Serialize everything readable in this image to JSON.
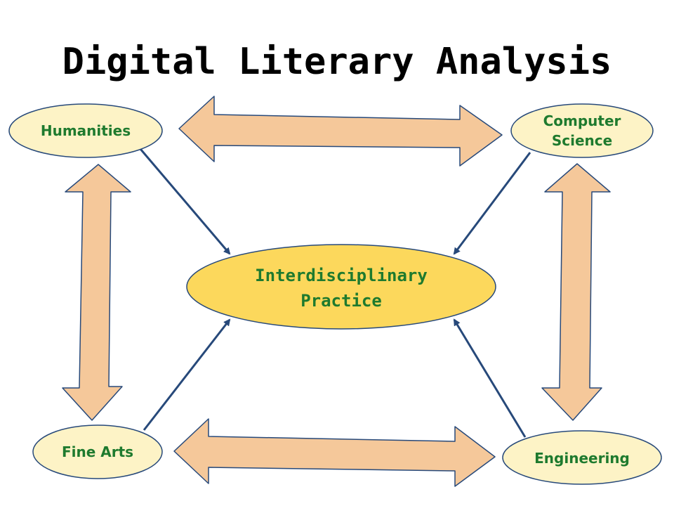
{
  "title": "Digital Literary Analysis",
  "center": {
    "lines": [
      "Interdisciplinary",
      "Practice"
    ]
  },
  "nodes": {
    "humanities": {
      "lines": [
        "Humanities"
      ]
    },
    "computer_science": {
      "lines": [
        "Computer",
        "Science"
      ]
    },
    "fine_arts": {
      "lines": [
        "Fine Arts"
      ]
    },
    "engineering": {
      "lines": [
        "Engineering"
      ]
    }
  },
  "colors": {
    "node_fill": "#fdf3c6",
    "center_fill": "#fcd85c",
    "outline": "#27497a",
    "arrow_fill": "#f5c89a",
    "label_text": "#1e7a2e"
  },
  "connections": [
    {
      "from": "humanities",
      "to": "computer_science",
      "type": "double"
    },
    {
      "from": "humanities",
      "to": "fine_arts",
      "type": "double"
    },
    {
      "from": "computer_science",
      "to": "engineering",
      "type": "double"
    },
    {
      "from": "fine_arts",
      "to": "engineering",
      "type": "double"
    },
    {
      "from": "humanities",
      "to": "center",
      "type": "arrow"
    },
    {
      "from": "computer_science",
      "to": "center",
      "type": "arrow"
    },
    {
      "from": "fine_arts",
      "to": "center",
      "type": "arrow"
    },
    {
      "from": "engineering",
      "to": "center",
      "type": "arrow"
    }
  ]
}
